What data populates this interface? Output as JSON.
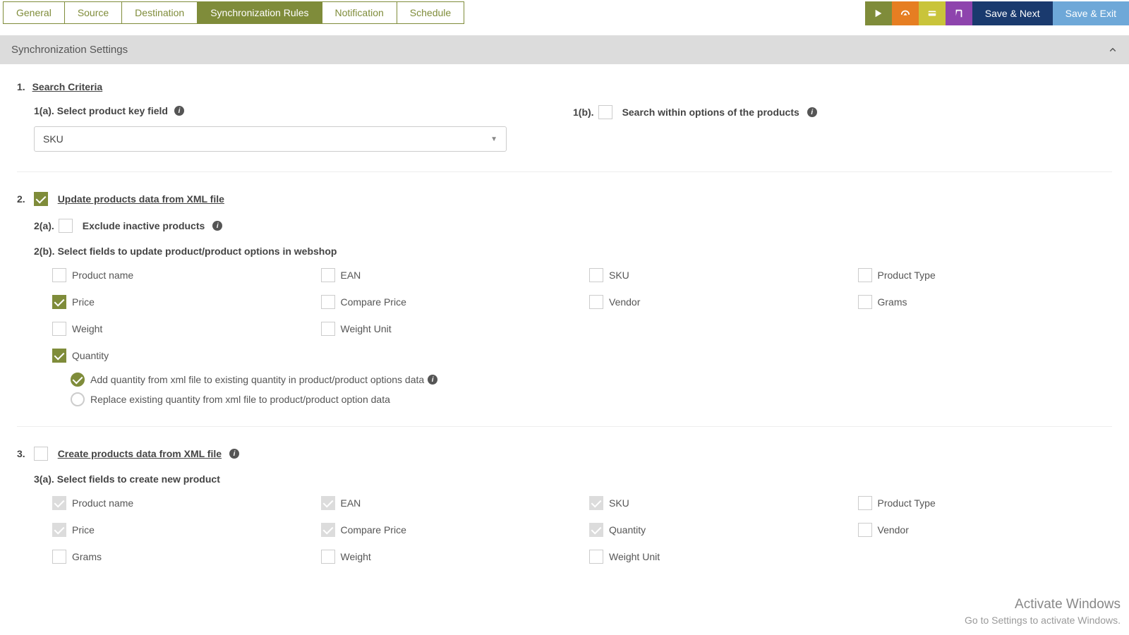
{
  "tabs": {
    "general": "General",
    "source": "Source",
    "destination": "Destination",
    "sync_rules": "Synchronization Rules",
    "notification": "Notification",
    "schedule": "Schedule"
  },
  "actions": {
    "save_next": "Save & Next",
    "save_exit": "Save & Exit"
  },
  "panel": {
    "title": "Synchronization Settings"
  },
  "sec1": {
    "num": "1.",
    "title": "Search Criteria",
    "a_prefix": "1(a).",
    "a_label": "Select product key field",
    "select_value": "SKU",
    "b_prefix": "1(b).",
    "b_label": "Search within options of the products"
  },
  "sec2": {
    "num": "2.",
    "title": "Update products data from XML file",
    "a_prefix": "2(a).",
    "a_label": "Exclude inactive products",
    "b_prefix": "2(b).",
    "b_label": "Select fields to update product/product options in webshop",
    "fields": {
      "product_name": "Product name",
      "ean": "EAN",
      "sku": "SKU",
      "product_type": "Product Type",
      "price": "Price",
      "compare_price": "Compare Price",
      "vendor": "Vendor",
      "grams": "Grams",
      "weight": "Weight",
      "weight_unit": "Weight Unit",
      "quantity": "Quantity"
    },
    "radio_add": "Add quantity from xml file to existing quantity in product/product options data",
    "radio_replace": "Replace existing quantity from xml file to product/product option data"
  },
  "sec3": {
    "num": "3.",
    "title": "Create products data from XML file",
    "a_prefix": "3(a).",
    "a_label": "Select fields to create new product",
    "fields": {
      "product_name": "Product name",
      "ean": "EAN",
      "sku": "SKU",
      "product_type": "Product Type",
      "price": "Price",
      "compare_price": "Compare Price",
      "quantity": "Quantity",
      "vendor": "Vendor",
      "grams": "Grams",
      "weight": "Weight",
      "weight_unit": "Weight Unit"
    }
  },
  "watermark": {
    "line1": "Activate Windows",
    "line2": "Go to Settings to activate Windows."
  }
}
